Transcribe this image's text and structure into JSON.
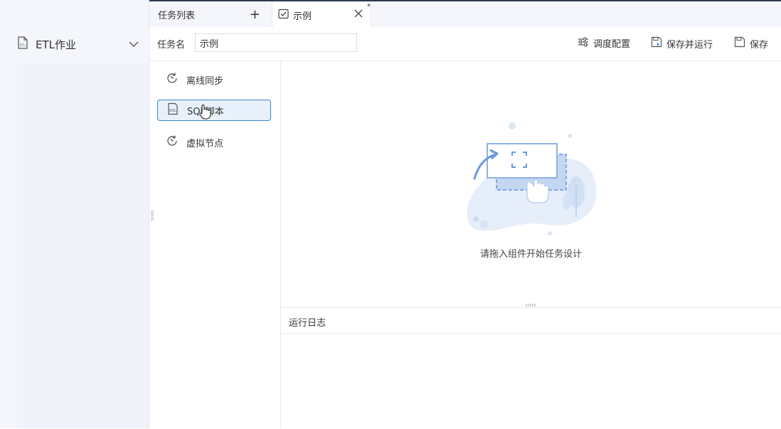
{
  "nav": {
    "section_label": "ETL作业"
  },
  "tabs": {
    "list_label": "任务列表",
    "add_symbol": "+",
    "active_label": "示例",
    "modified_marker": "*"
  },
  "toolbar": {
    "task_name_label": "任务名",
    "task_name_value": "示例",
    "schedule_label": "调度配置",
    "save_run_label": "保存并运行",
    "save_label": "保存"
  },
  "components": [
    {
      "label": "离线同步",
      "icon": "sync-icon"
    },
    {
      "label": "SQL脚本",
      "icon": "sql-file-icon"
    },
    {
      "label": "虚拟节点",
      "icon": "sync-icon"
    }
  ],
  "canvas": {
    "empty_text": "请拖入组件开始任务设计"
  },
  "log": {
    "title": "运行日志"
  },
  "colors": {
    "accent": "#3d82d1",
    "selected_bg": "#e8f1fb",
    "topbar": "#2f3a52",
    "sidebar_bg": "#f4f6fb"
  }
}
